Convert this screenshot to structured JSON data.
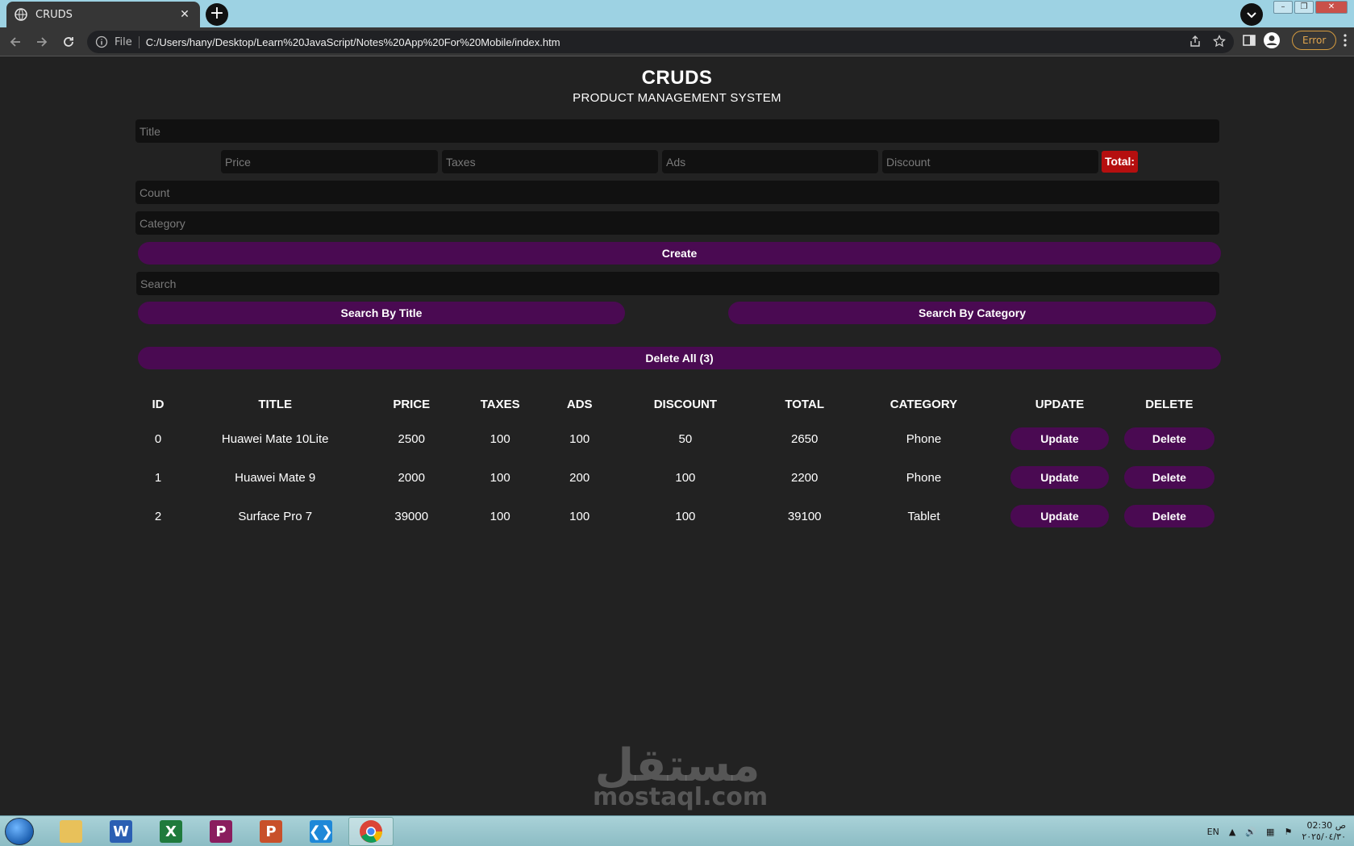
{
  "browser": {
    "tab_title": "CRUDS",
    "address_prefix": "File",
    "url": "C:/Users/hany/Desktop/Learn%20JavaScript/Notes%20App%20For%20Mobile/index.htm",
    "error_label": "Error"
  },
  "header": {
    "title": "CRUDS",
    "subtitle": "PRODUCT MANAGEMENT SYSTEM"
  },
  "form": {
    "title_placeholder": "Title",
    "price_placeholder": "Price",
    "taxes_placeholder": "Taxes",
    "ads_placeholder": "Ads",
    "discount_placeholder": "Discount",
    "total_label": "Total:",
    "count_placeholder": "Count",
    "category_placeholder": "Category",
    "create_label": "Create",
    "search_placeholder": "Search",
    "search_title_label": "Search By Title",
    "search_category_label": "Search By Category",
    "delete_all_label": "Delete All (3)"
  },
  "table": {
    "headers": [
      "ID",
      "TITLE",
      "PRICE",
      "TAXES",
      "ADS",
      "DISCOUNT",
      "TOTAL",
      "CATEGORY",
      "UPDATE",
      "DELETE"
    ],
    "rows": [
      {
        "id": "0",
        "title": "Huawei Mate 10Lite",
        "price": "2500",
        "taxes": "100",
        "ads": "100",
        "discount": "50",
        "total": "2650",
        "category": "Phone",
        "update": "Update",
        "delete": "Delete"
      },
      {
        "id": "1",
        "title": "Huawei Mate 9",
        "price": "2000",
        "taxes": "100",
        "ads": "200",
        "discount": "100",
        "total": "2200",
        "category": "Phone",
        "update": "Update",
        "delete": "Delete"
      },
      {
        "id": "2",
        "title": "Surface Pro 7",
        "price": "39000",
        "taxes": "100",
        "ads": "100",
        "discount": "100",
        "total": "39100",
        "category": "Tablet",
        "update": "Update",
        "delete": "Delete"
      }
    ]
  },
  "watermark": {
    "arabic": "مستقل",
    "latin": "mostaql.com"
  },
  "taskbar": {
    "language": "EN",
    "time": "02:30 ص",
    "date": "٢٠٢٥/٠٤/٣٠"
  },
  "colors": {
    "page_bg": "#222222",
    "input_bg": "#111111",
    "button_purple": "#4a0a52",
    "total_red": "#b50f0f"
  }
}
